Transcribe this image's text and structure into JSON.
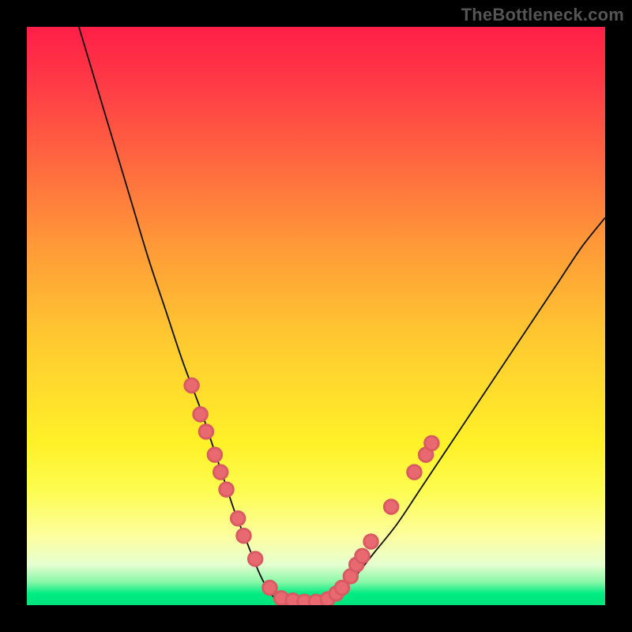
{
  "watermark": "TheBottleneck.com",
  "colors": {
    "frame": "#000000",
    "curve": "#111111",
    "dot_fill": "#e86a70",
    "dot_stroke": "#d95a63",
    "watermark": "#555555"
  },
  "chart_data": {
    "type": "line",
    "title": "",
    "xlabel": "",
    "ylabel": "",
    "xlim": [
      0,
      100
    ],
    "ylim": [
      0,
      100
    ],
    "grid": false,
    "legend": false,
    "note": "No axis tick labels or numeric labels are rendered in the image; x/y are normalized 0–100 estimates read from pixel position.",
    "series": [
      {
        "name": "curve-left",
        "x": [
          9,
          12,
          15,
          18,
          21,
          24,
          27,
          30,
          32,
          34,
          36,
          38,
          40,
          41.5,
          43
        ],
        "y": [
          100,
          90,
          80,
          70,
          60,
          51,
          42,
          34,
          28,
          22,
          16,
          11,
          6,
          3,
          1
        ]
      },
      {
        "name": "curve-bottom",
        "x": [
          43,
          45,
          47,
          49,
          51,
          53
        ],
        "y": [
          1,
          0.5,
          0.4,
          0.4,
          0.6,
          1.2
        ]
      },
      {
        "name": "curve-right",
        "x": [
          53,
          56,
          60,
          64,
          68,
          72,
          76,
          80,
          84,
          88,
          92,
          96,
          100
        ],
        "y": [
          1.2,
          4,
          9,
          14,
          20,
          26,
          32,
          38,
          44,
          50,
          56,
          62,
          67
        ]
      }
    ],
    "points": [
      {
        "name": "left-cluster",
        "x": 28.5,
        "y": 38
      },
      {
        "name": "left-cluster",
        "x": 30.0,
        "y": 33
      },
      {
        "name": "left-cluster",
        "x": 31.0,
        "y": 30
      },
      {
        "name": "left-cluster",
        "x": 32.5,
        "y": 26
      },
      {
        "name": "left-cluster",
        "x": 33.5,
        "y": 23
      },
      {
        "name": "left-cluster",
        "x": 34.5,
        "y": 20
      },
      {
        "name": "left-cluster",
        "x": 36.5,
        "y": 15
      },
      {
        "name": "left-cluster",
        "x": 37.5,
        "y": 12
      },
      {
        "name": "left-cluster",
        "x": 39.5,
        "y": 8
      },
      {
        "name": "left-cluster",
        "x": 42.0,
        "y": 3
      },
      {
        "name": "bottom-cluster",
        "x": 44.0,
        "y": 1.2
      },
      {
        "name": "bottom-cluster",
        "x": 46.0,
        "y": 0.8
      },
      {
        "name": "bottom-cluster",
        "x": 48.0,
        "y": 0.6
      },
      {
        "name": "bottom-cluster",
        "x": 50.0,
        "y": 0.6
      },
      {
        "name": "bottom-cluster",
        "x": 52.0,
        "y": 1.0
      },
      {
        "name": "right-cluster",
        "x": 53.5,
        "y": 2.0
      },
      {
        "name": "right-cluster",
        "x": 54.5,
        "y": 3.0
      },
      {
        "name": "right-cluster",
        "x": 56.0,
        "y": 5.0
      },
      {
        "name": "right-cluster",
        "x": 57.0,
        "y": 7.0
      },
      {
        "name": "right-cluster",
        "x": 58.0,
        "y": 8.5
      },
      {
        "name": "right-cluster",
        "x": 59.5,
        "y": 11.0
      },
      {
        "name": "right-cluster",
        "x": 63.0,
        "y": 17.0
      },
      {
        "name": "right-cluster",
        "x": 67.0,
        "y": 23.0
      },
      {
        "name": "right-cluster",
        "x": 69.0,
        "y": 26.0
      },
      {
        "name": "right-cluster",
        "x": 70.0,
        "y": 28.0
      }
    ],
    "dot_radius": 1.2
  }
}
